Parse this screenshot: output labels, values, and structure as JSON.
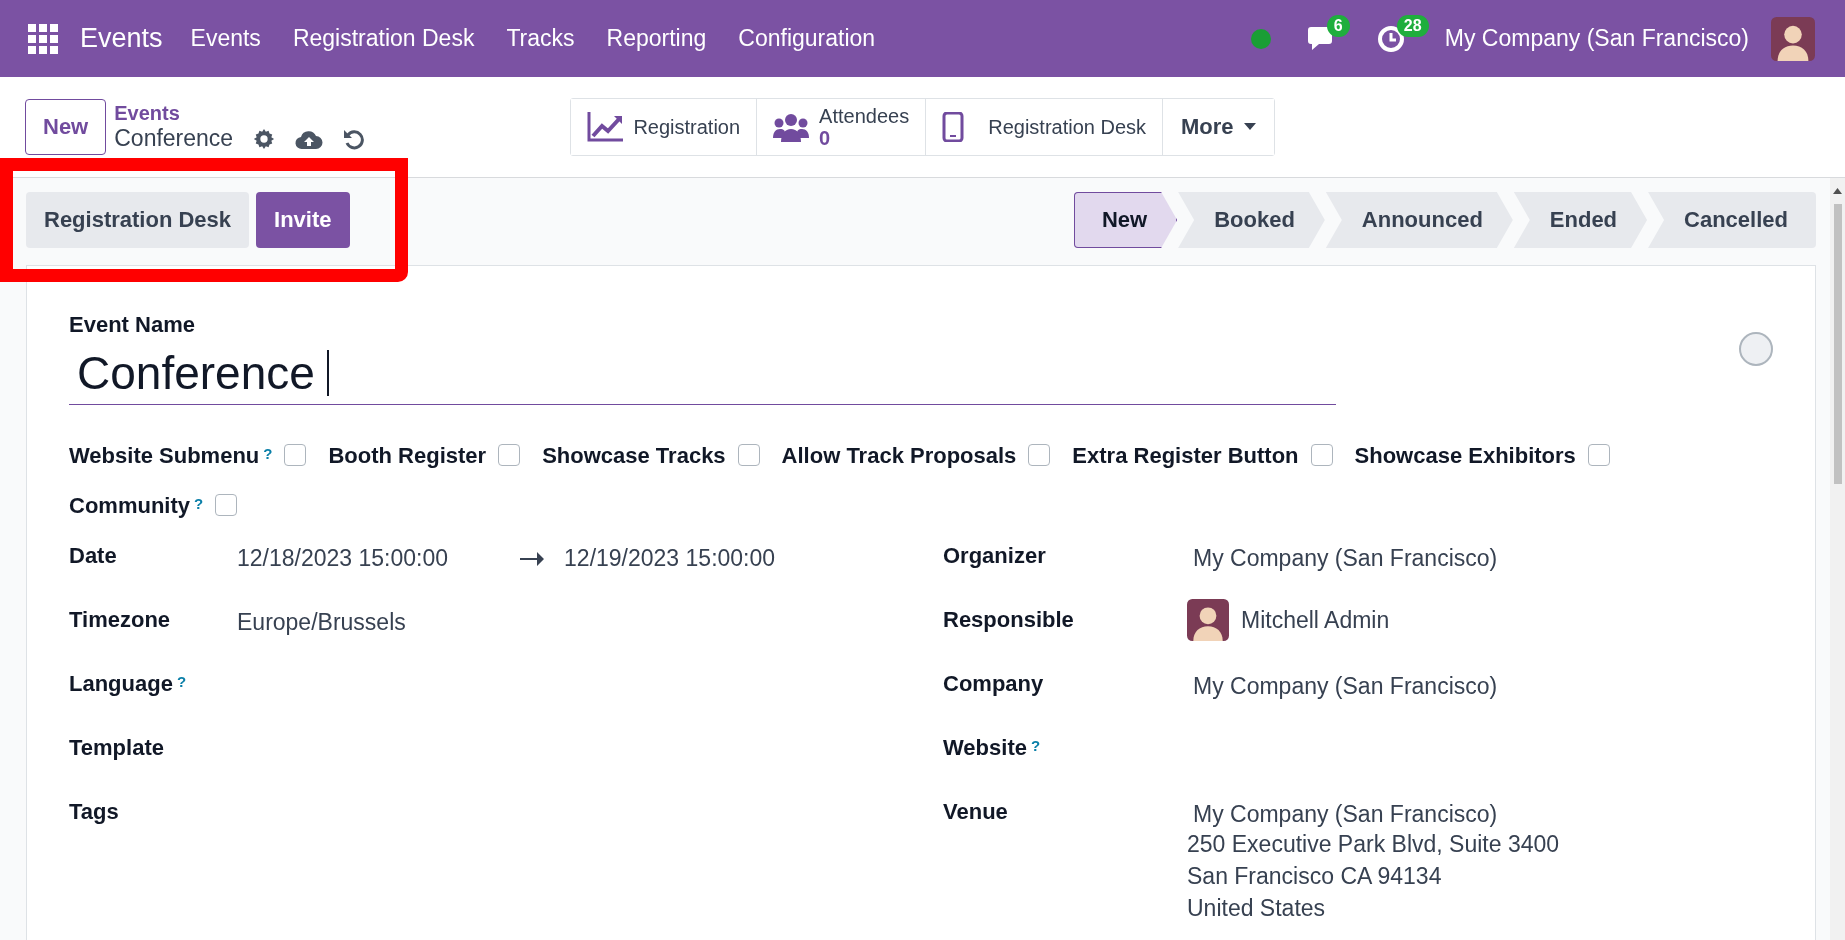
{
  "navbar": {
    "app": "Events",
    "menu": [
      "Events",
      "Registration Desk",
      "Tracks",
      "Reporting",
      "Configuration"
    ],
    "messages_count": "6",
    "activities_count": "28",
    "company": "My Company (San Francisco)"
  },
  "control_panel": {
    "new_button": "New",
    "breadcrumb_parent": "Events",
    "breadcrumb_current": "Conference",
    "smart_buttons": [
      {
        "kind": "chart",
        "label": "Registration"
      },
      {
        "kind": "people",
        "label": "Attendees",
        "value": "0"
      },
      {
        "kind": "phone",
        "label": "Registration Desk"
      }
    ],
    "more": "More"
  },
  "header_buttons": [
    {
      "label": "Registration Desk",
      "primary": false
    },
    {
      "label": "Invite",
      "primary": true
    }
  ],
  "stages": [
    {
      "label": "New",
      "selected": true
    },
    {
      "label": "Booked",
      "selected": false
    },
    {
      "label": "Announced",
      "selected": false
    },
    {
      "label": "Ended",
      "selected": false
    },
    {
      "label": "Cancelled",
      "selected": false
    }
  ],
  "form": {
    "name_label": "Event Name",
    "name_value": "Conference",
    "options": [
      {
        "label": "Website Submenu",
        "help": "?",
        "checked": false
      },
      {
        "label": "Booth Register",
        "checked": false
      },
      {
        "label": "Showcase Tracks",
        "checked": false
      },
      {
        "label": "Allow Track Proposals",
        "checked": false
      },
      {
        "label": "Extra Register Button",
        "checked": false
      },
      {
        "label": "Showcase Exhibitors",
        "checked": false
      },
      {
        "label": "Community",
        "help": "?",
        "checked": false
      }
    ],
    "left_fields": [
      {
        "label": "Date",
        "kind": "range",
        "start": "12/18/2023 15:00:00",
        "end": "12/19/2023 15:00:00"
      },
      {
        "label": "Timezone",
        "kind": "text",
        "value": "Europe/Brussels"
      },
      {
        "label": "Language",
        "help": "?",
        "kind": "empty"
      },
      {
        "label": "Template",
        "kind": "empty"
      },
      {
        "label": "Tags",
        "kind": "empty"
      }
    ],
    "right_fields": [
      {
        "label": "Organizer",
        "kind": "text",
        "value": "My Company (San Francisco)"
      },
      {
        "label": "Responsible",
        "kind": "user",
        "value": "Mitchell Admin"
      },
      {
        "label": "Company",
        "kind": "text",
        "value": "My Company (San Francisco)"
      },
      {
        "label": "Website",
        "help": "?",
        "kind": "empty"
      },
      {
        "label": "Venue",
        "kind": "address",
        "value": "My Company (San Francisco)",
        "lines": [
          "250 Executive Park Blvd, Suite 3400",
          "San Francisco CA 94134",
          "United States"
        ]
      }
    ]
  }
}
